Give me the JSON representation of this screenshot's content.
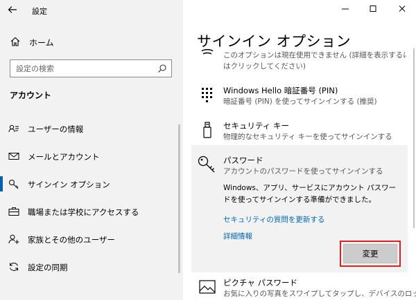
{
  "app": {
    "title": "設定",
    "back_icon": "back-arrow-icon"
  },
  "sidebar": {
    "home_label": "ホーム",
    "search_placeholder": "設定の検索",
    "section_title": "アカウント",
    "items": [
      {
        "label": "ユーザーの情報",
        "icon": "user-info-icon",
        "active": false
      },
      {
        "label": "メールとアカウント",
        "icon": "mail-icon",
        "active": false
      },
      {
        "label": "サインイン オプション",
        "icon": "key-icon",
        "active": true
      },
      {
        "label": "職場または学校にアクセスする",
        "icon": "briefcase-icon",
        "active": false
      },
      {
        "label": "家族とその他のユーザー",
        "icon": "add-user-icon",
        "active": false
      },
      {
        "label": "設定の同期",
        "icon": "sync-icon",
        "active": false
      }
    ]
  },
  "window": {
    "controls": [
      "minimize-icon",
      "maximize-icon",
      "close-icon"
    ]
  },
  "main": {
    "title": "サインイン オプション",
    "cut_off_lines": [
      "このオプションは現在使用できません (詳細を表示するに",
      "はクリックしてください)"
    ],
    "options": [
      {
        "title": "Windows Hello 暗証番号 (PIN)",
        "desc": "暗証番号 (PIN) を使ってサインインする (推奨)",
        "icon": "pin-keypad-icon"
      },
      {
        "title": "セキュリティ キー",
        "desc": "物理的なセキュリティ キーを使ってサインインする",
        "icon": "usb-key-icon"
      },
      {
        "title": "ピクチャ パスワード",
        "desc": "お気に入りの写真をスワイプしてタップし、デバイスのロッ",
        "icon": "picture-icon"
      }
    ],
    "password": {
      "title": "パスワード",
      "desc": "アカウントのパスワードを使ってサインインする",
      "message": "Windows、アプリ、サービスにアカウント パスワードを使ってサインインする準備ができました。",
      "link_security": "セキュリティの質問を更新する",
      "link_details": "詳細情報",
      "change_label": "変更",
      "icon": "key-icon",
      "highlight_color": "#e0201c"
    }
  },
  "colors": {
    "accent": "#0063b1",
    "link": "#0066b4",
    "sidebar_bg": "#f2f2f2"
  }
}
